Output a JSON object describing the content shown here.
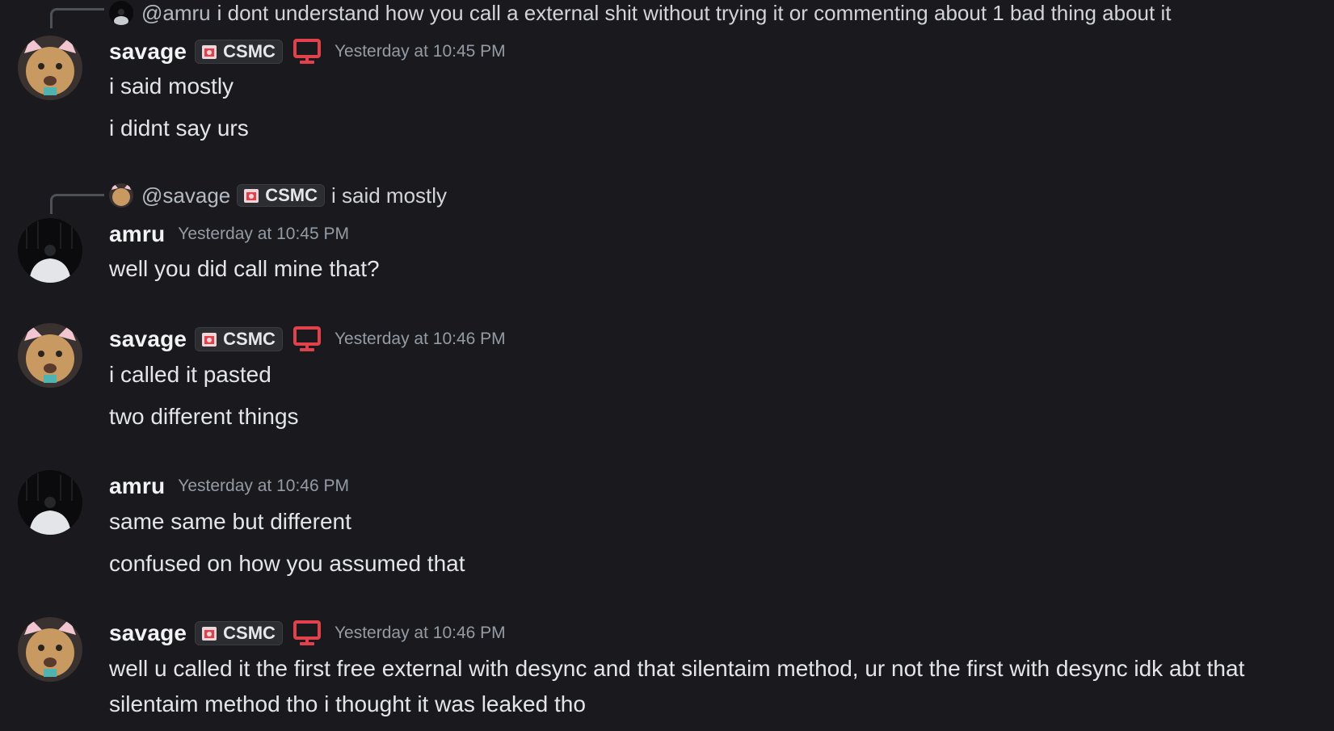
{
  "messages": [
    {
      "reply": {
        "mention": "@amru",
        "text": "i dont understand how you call a external shit without trying it or commenting about 1 bad thing about it"
      },
      "author": "savage",
      "tag": "CSMC",
      "timestamp": "Yesterday at 10:45 PM",
      "lines": [
        "i said mostly",
        "i didnt say urs"
      ]
    },
    {
      "reply": {
        "mention": "@savage",
        "tag": "CSMC",
        "text": "i said mostly"
      },
      "author": "amru",
      "timestamp": "Yesterday at 10:45 PM",
      "lines": [
        "well you did call mine that?"
      ]
    },
    {
      "author": "savage",
      "tag": "CSMC",
      "timestamp": "Yesterday at 10:46 PM",
      "lines": [
        "i called it pasted",
        "two different things"
      ]
    },
    {
      "author": "amru",
      "timestamp": "Yesterday at 10:46 PM",
      "lines": [
        "same same but different",
        "confused on how you assumed that"
      ]
    },
    {
      "author": "savage",
      "tag": "CSMC",
      "timestamp": "Yesterday at 10:46 PM",
      "lines": [
        "well u called it the first free external with desync and that silentaim method, ur not the first with desync idk abt that silentaim method tho i thought it was leaked tho"
      ]
    }
  ],
  "colors": {
    "background": "#1a1a1e",
    "device_icon": "#e0414a",
    "timestamp": "#949ba4"
  },
  "icons": {
    "tag_icon": "castle-badge-icon",
    "device_icon": "desktop-icon"
  }
}
